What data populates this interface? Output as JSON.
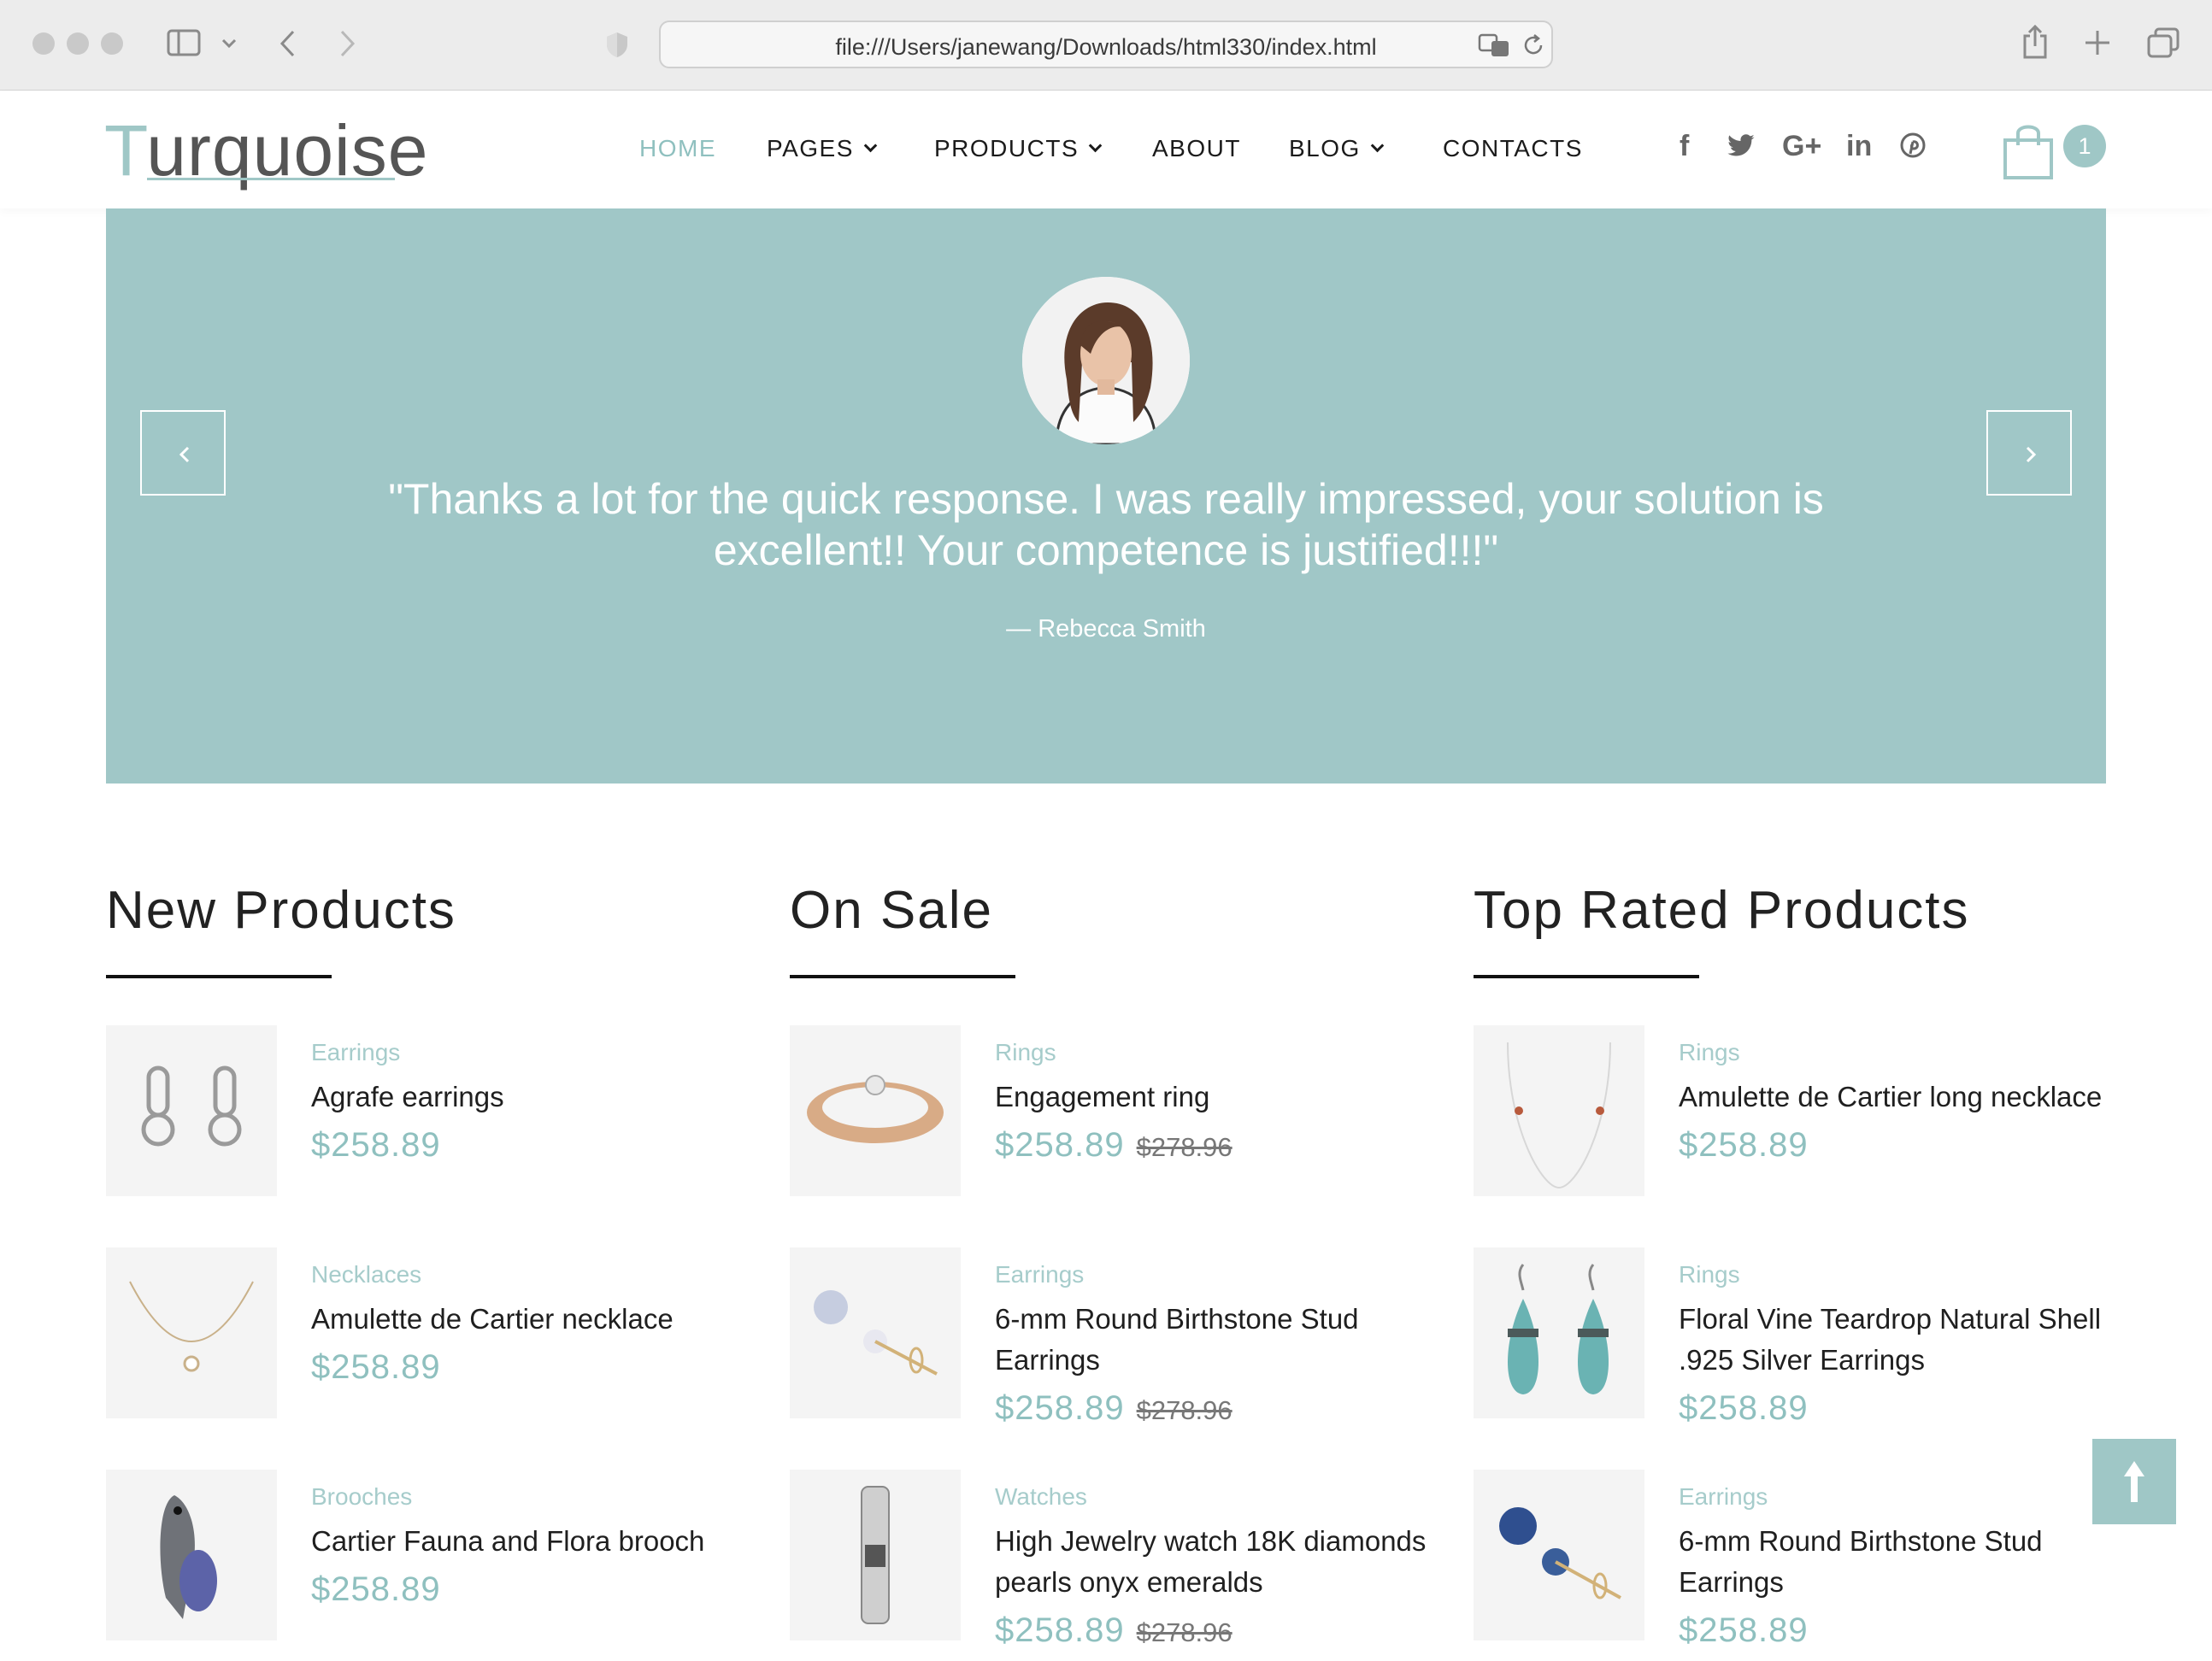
{
  "browser": {
    "url": "file:///Users/janewang/Downloads/html330/index.html"
  },
  "header": {
    "logo_first": "T",
    "logo_rest": "urquoise",
    "nav": [
      {
        "label": "HOME",
        "active": true,
        "dropdown": false
      },
      {
        "label": "PAGES",
        "active": false,
        "dropdown": true
      },
      {
        "label": "PRODUCTS",
        "active": false,
        "dropdown": true
      },
      {
        "label": "ABOUT",
        "active": false,
        "dropdown": false
      },
      {
        "label": "BLOG",
        "active": false,
        "dropdown": true
      },
      {
        "label": "CONTACTS",
        "active": false,
        "dropdown": false
      }
    ],
    "social_icons": [
      "facebook-icon",
      "twitter-icon",
      "google-plus-icon",
      "linkedin-icon",
      "pinterest-icon"
    ],
    "social_glyphs": [
      "f",
      "🐦",
      "G+",
      "in",
      "℗"
    ],
    "cart_count": "1"
  },
  "testimonial": {
    "quote": "\"Thanks a lot for the quick response. I was really impressed, your solution is excellent!! Your competence is justified!!!\"",
    "author": "— Rebecca Smith"
  },
  "columns": [
    {
      "title": "New Products",
      "products": [
        {
          "category": "Earrings",
          "name": "Agrafe earrings",
          "price": "$258.89",
          "old_price": ""
        },
        {
          "category": "Necklaces",
          "name": "Amulette de Cartier necklace",
          "price": "$258.89",
          "old_price": ""
        },
        {
          "category": "Brooches",
          "name": "Cartier Fauna and Flora brooch",
          "price": "$258.89",
          "old_price": ""
        }
      ]
    },
    {
      "title": "On Sale",
      "products": [
        {
          "category": "Rings",
          "name": "Engagement ring",
          "price": "$258.89",
          "old_price": "$278.96"
        },
        {
          "category": "Earrings",
          "name": "6-mm Round Birthstone Stud Earrings",
          "price": "$258.89",
          "old_price": "$278.96"
        },
        {
          "category": "Watches",
          "name": "High Jewelry watch 18K diamonds pearls onyx emeralds",
          "price": "$258.89",
          "old_price": "$278.96"
        }
      ]
    },
    {
      "title": "Top Rated Products",
      "products": [
        {
          "category": "Rings",
          "name": "Amulette de Cartier long necklace",
          "price": "$258.89",
          "old_price": ""
        },
        {
          "category": "Rings",
          "name": "Floral Vine Teardrop Natural Shell .925 Silver Earrings",
          "price": "$258.89",
          "old_price": ""
        },
        {
          "category": "Earrings",
          "name": "6-mm Round Birthstone Stud Earrings",
          "price": "$258.89",
          "old_price": ""
        }
      ]
    }
  ],
  "colors": {
    "accent": "#9fc7c6",
    "slider_bg": "#a0c7c7",
    "price": "#8fc0bf"
  }
}
